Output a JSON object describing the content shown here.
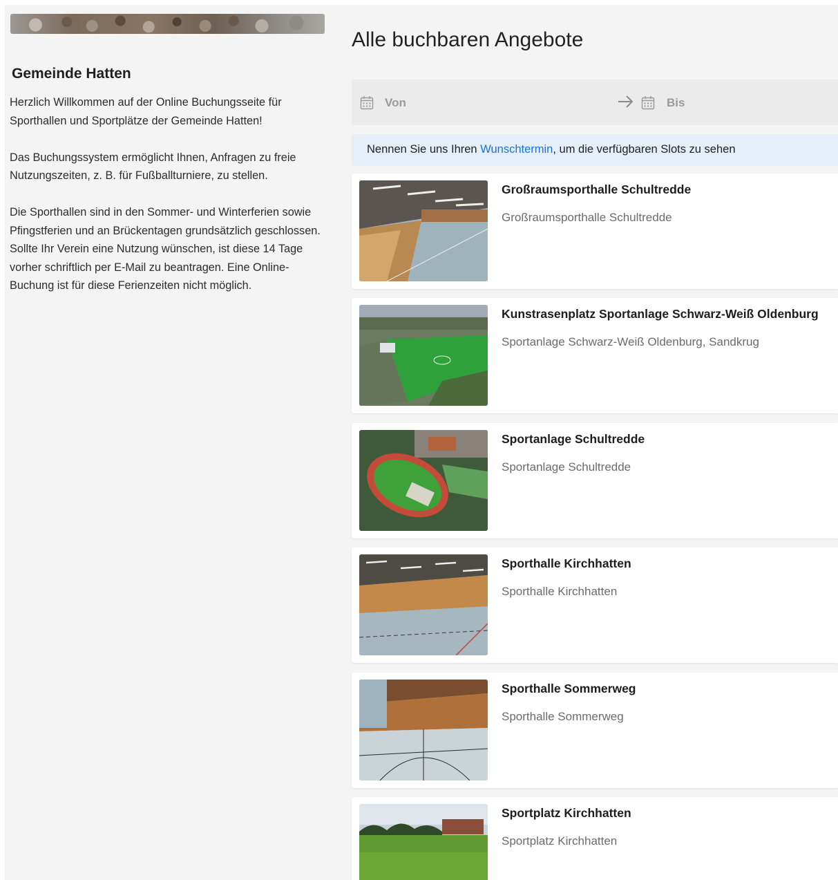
{
  "sidebar": {
    "title": "Gemeinde Hatten",
    "paragraphs": [
      "Herzlich Willkommen auf der Online Buchungsseite für Sporthallen und Sportplätze der Gemeinde Hatten!",
      "Das Buchungssystem ermöglicht Ihnen, Anfragen zu freie Nutzungszeiten, z. B. für Fußballturniere, zu stellen.",
      "Die Sporthallen sind in den Sommer- und Winterferien sowie Pfingstferien und an Brückentagen grundsätzlich geschlossen. Sollte Ihr Verein eine Nutzung wünschen, ist diese 14 Tage vorher schriftlich per E-Mail zu beantragen. Eine Online-Buchung ist für diese Ferienzeiten nicht möglich."
    ]
  },
  "main": {
    "title": "Alle buchbaren Angebote",
    "date_range": {
      "from_label": "Von",
      "to_label": "Bis",
      "calendar_icon": "calendar-icon",
      "arrow_icon": "arrow-right-icon"
    },
    "info": {
      "prefix": "Nennen Sie uns Ihren ",
      "link": "Wunschtermin",
      "suffix": ", um die verfügbaren Slots zu sehen"
    },
    "offers": [
      {
        "title": "Großraumsporthalle Schultredde",
        "subtitle": "Großraumsporthalle Schultredde"
      },
      {
        "title": "Kunstrasenplatz Sportanlage Schwarz-Weiß Oldenburg",
        "subtitle": "Sportanlage Schwarz-Weiß Oldenburg, Sandkrug"
      },
      {
        "title": "Sportanlage Schultredde",
        "subtitle": "Sportanlage Schultredde"
      },
      {
        "title": "Sporthalle Kirchhatten",
        "subtitle": "Sporthalle Kirchhatten"
      },
      {
        "title": "Sporthalle Sommerweg",
        "subtitle": "Sporthalle Sommerweg"
      },
      {
        "title": "Sportplatz Kirchhatten",
        "subtitle": "Sportplatz Kirchhatten"
      }
    ]
  },
  "colors": {
    "page_bg": "#f4f4f4",
    "link": "#1a73d9",
    "info_bg": "#e6eef7",
    "date_bar_bg": "#ebebeb"
  }
}
